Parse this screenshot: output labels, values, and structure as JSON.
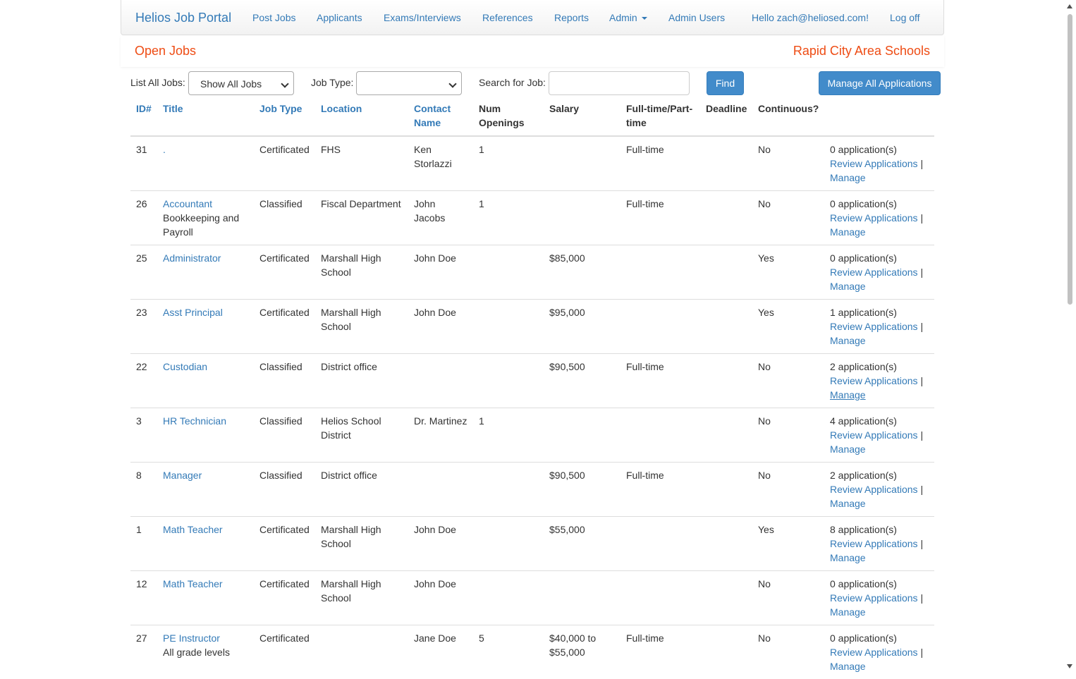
{
  "navbar": {
    "brand": "Helios Job Portal",
    "items": [
      "Post Jobs",
      "Applicants",
      "Exams/Interviews",
      "References",
      "Reports",
      "Admin",
      "Admin Users"
    ],
    "greeting": "Hello zach@heliosed.com!",
    "logoff": "Log off"
  },
  "title": {
    "page": "Open Jobs",
    "org": "Rapid City Area Schools"
  },
  "filters": {
    "list_all_label": "List All Jobs:",
    "list_all_value": "Show All Jobs",
    "job_type_label": "Job Type:",
    "job_type_value": "",
    "search_label": "Search for Job:",
    "search_value": "",
    "find": "Find",
    "manage_all": "Manage All Applications"
  },
  "table": {
    "headers": [
      "ID#",
      "Title",
      "Job Type",
      "Location",
      "Contact Name",
      "Num Openings",
      "Salary",
      "Full-time/Part-time",
      "Deadline",
      "Continuous?",
      ""
    ],
    "review_label": "Review Applications",
    "manage_label": "Manage",
    "separator": "|",
    "rows": [
      {
        "id": "31",
        "title": ".",
        "subtitle": "",
        "type": "Certificated",
        "location": "FHS",
        "contact": "Ken Storlazzi",
        "openings": "1",
        "salary": "",
        "fulltime": "Full-time",
        "deadline": "",
        "continuous": "No",
        "apps": "0 application(s)"
      },
      {
        "id": "26",
        "title": "Accountant",
        "subtitle": "Bookkeeping and Payroll",
        "type": "Classified",
        "location": "Fiscal Department",
        "contact": "John Jacobs",
        "openings": "1",
        "salary": "",
        "fulltime": "Full-time",
        "deadline": "",
        "continuous": "No",
        "apps": "0 application(s)"
      },
      {
        "id": "25",
        "title": "Administrator",
        "subtitle": "",
        "type": "Certificated",
        "location": "Marshall High School",
        "contact": "John Doe",
        "openings": "",
        "salary": "$85,000",
        "fulltime": "",
        "deadline": "",
        "continuous": "Yes",
        "apps": "0 application(s)"
      },
      {
        "id": "23",
        "title": "Asst Principal",
        "subtitle": "",
        "type": "Certificated",
        "location": "Marshall High School",
        "contact": "John Doe",
        "openings": "",
        "salary": "$95,000",
        "fulltime": "",
        "deadline": "",
        "continuous": "Yes",
        "apps": "1 application(s)"
      },
      {
        "id": "22",
        "title": "Custodian",
        "subtitle": "",
        "type": "Classified",
        "location": "District office",
        "contact": "",
        "openings": "",
        "salary": "$90,500",
        "fulltime": "Full-time",
        "deadline": "",
        "continuous": "No",
        "apps": "2 application(s)"
      },
      {
        "id": "3",
        "title": "HR Technician",
        "subtitle": "",
        "type": "Classified",
        "location": "Helios School District",
        "contact": "Dr. Martinez",
        "openings": "1",
        "salary": "",
        "fulltime": "",
        "deadline": "",
        "continuous": "No",
        "apps": "4 application(s)"
      },
      {
        "id": "8",
        "title": "Manager",
        "subtitle": "",
        "type": "Classified",
        "location": "District office",
        "contact": "",
        "openings": "",
        "salary": "$90,500",
        "fulltime": "Full-time",
        "deadline": "",
        "continuous": "No",
        "apps": "2 application(s)"
      },
      {
        "id": "1",
        "title": "Math Teacher",
        "subtitle": "",
        "type": "Certificated",
        "location": "Marshall High School",
        "contact": "John Doe",
        "openings": "",
        "salary": "$55,000",
        "fulltime": "",
        "deadline": "",
        "continuous": "Yes",
        "apps": "8 application(s)"
      },
      {
        "id": "12",
        "title": "Math Teacher",
        "subtitle": "",
        "type": "Certificated",
        "location": "Marshall High School",
        "contact": "John Doe",
        "openings": "",
        "salary": "",
        "fulltime": "",
        "deadline": "",
        "continuous": "No",
        "apps": "0 application(s)"
      },
      {
        "id": "27",
        "title": "PE Instructor",
        "subtitle": "All grade levels",
        "type": "Certificated",
        "location": "",
        "contact": "Jane Doe",
        "openings": "5",
        "salary": "$40,000 to $55,000",
        "fulltime": "Full-time",
        "deadline": "",
        "continuous": "No",
        "apps": "0 application(s)"
      }
    ]
  }
}
